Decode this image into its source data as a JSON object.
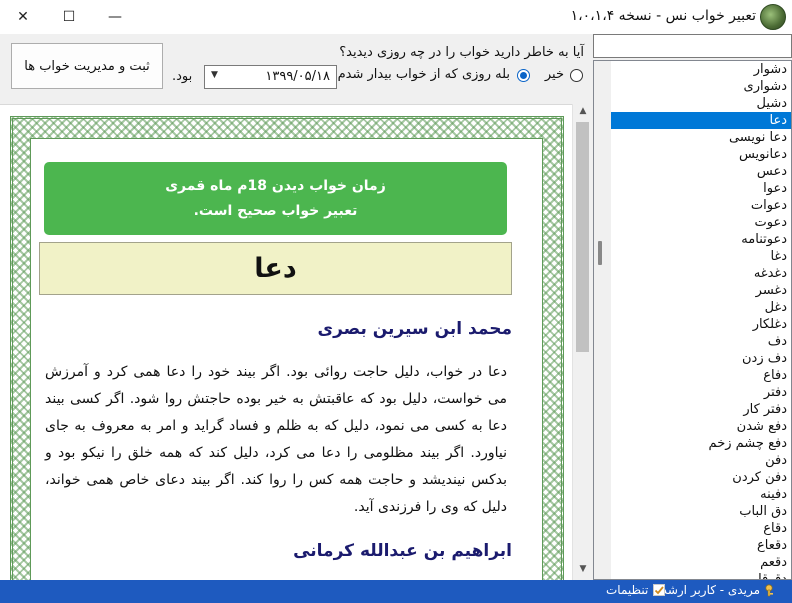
{
  "window": {
    "title": "تعبیر خواب نس - نسخه ۱،۰،۱،۴",
    "close_glyph": "✕",
    "maximize_glyph": "☐",
    "minimize_glyph": "—"
  },
  "form": {
    "register_button": "ثبت و مدیریت خواب ها",
    "question": "آیا به خاطر دارید خواب را در چه روزی دیدید؟",
    "option_no": "خیر",
    "option_yes": "بله روزی که از خواب بیدار شدم",
    "date_value": "۱۳۹۹/۰۵/۱۸",
    "suffix": "بود."
  },
  "content": {
    "banner_line1": "زمان خواب دیدن 18م ماه قمری",
    "banner_line2": "تعبیر خواب صحیح است.",
    "word": "دعا",
    "author1": "محمد ابن سیرین بصری",
    "paragraph1": "دعا در خواب، دلیل حاجت روائی بود. اگر بیند خود را دعا همی کرد و آمرزش می خواست، دلیل بود که عاقبتش به خیر بوده حاجتش روا شود. اگر کسی بیند دعا به کسی می نمود، دلیل که به ظلم و فساد گراید و امر به معروف به جای نیاورد. اگر بیند مظلومی را دعا می کرد، دلیل کند که همه خلق را نیکو بود و بدکس نیندیشد و حاجت همه کس را روا کند. اگر بیند دعای خاص همی خواند، دلیل که وی را فرزندی آید.",
    "author2": "ابراهیم بن عبدالله کرمانی"
  },
  "search": {
    "placeholder": ""
  },
  "word_list": {
    "items": [
      "دشوار",
      "دشواری",
      "دشیل",
      "دعا",
      "دعا نویسی",
      "دعانویس",
      "دعس",
      "دعوا",
      "دعوات",
      "دعوت",
      "دعوتنامه",
      "دغا",
      "دغدغه",
      "دغسر",
      "دغل",
      "دغلکار",
      "دف",
      "دف زدن",
      "دفاع",
      "دفتر",
      "دفتر کار",
      "دفع شدن",
      "دفع چشم زخم",
      "دفن",
      "دفن کردن",
      "دفینه",
      "دق الباب",
      "دقاع",
      "دقعاع",
      "دقعم",
      "دقوقا"
    ],
    "selected_index": 3
  },
  "status": {
    "user": "مریدی - کاربر ارشد",
    "settings": "تنظیمات"
  },
  "colors": {
    "banner": "#4cb64f",
    "word_box": "#f1f2c7",
    "author": "#1b1b6e",
    "statusbar": "#1e5abf",
    "selection": "#0078d7",
    "ornament": "#5e9a58"
  }
}
